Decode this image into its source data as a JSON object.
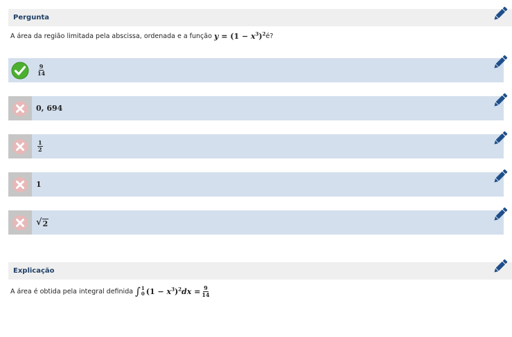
{
  "question": {
    "header": "Pergunta",
    "text": "A área da região limitada pela abscissa, ordenada e a função",
    "formula_y": "y",
    "formula_eq": " = ",
    "formula_body": "(1 − ",
    "formula_x": "x",
    "formula_exp3": "3",
    "formula_close": ")",
    "formula_exp2": "2",
    "text_end": "é?"
  },
  "options": [
    {
      "status": "correct",
      "num": "9",
      "den": "14"
    },
    {
      "status": "wrong",
      "value": "0, 694"
    },
    {
      "status": "wrong",
      "num": "1",
      "den": "2"
    },
    {
      "status": "wrong",
      "value": "1"
    },
    {
      "status": "wrong",
      "sqrt_symbol": "√",
      "sqrt_arg": "2"
    }
  ],
  "explanation": {
    "header": "Explicação",
    "text": "A área é obtida pela integral definida",
    "integral_symbol": "∫",
    "upper_limit": "1",
    "lower_limit": "0",
    "integrand_open": "(1 − ",
    "integrand_x": "x",
    "integrand_exp3": "3",
    "integrand_close": ")",
    "integrand_exp2": "2",
    "dx": "dx",
    "equals": " = ",
    "num": "9",
    "den": "14"
  },
  "icons": {
    "edit": "pencil-icon",
    "correct": "checkmark-icon",
    "wrong": "x-mark-icon"
  },
  "colors": {
    "header_bg": "#efefef",
    "header_text": "#1f3f66",
    "option_bg": "#d3dfed",
    "wrong_box": "#c6c6c6",
    "pencil": "#1f4f8a",
    "correct": "#4caf30"
  }
}
